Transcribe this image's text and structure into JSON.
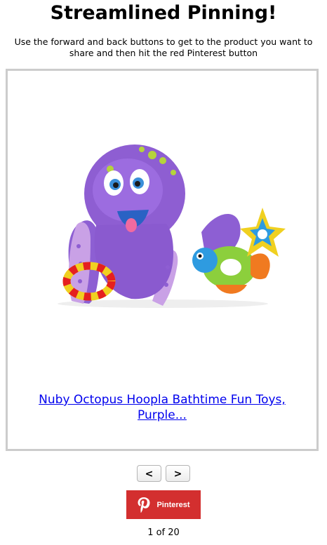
{
  "header": {
    "title": "Streamlined Pinning!",
    "instructions": "Use the forward and back buttons to get to the product you want to share and then hit the red Pinterest button"
  },
  "product": {
    "name": "Nuby Octopus Hoopla Bathtime Fun Toys, Purple...",
    "image_icon": "octopus-toy-image"
  },
  "navigation": {
    "back_label": "<",
    "forward_label": ">"
  },
  "pinterest": {
    "label": "Pinterest",
    "icon": "pinterest-logo-icon",
    "color": "#d32f2f"
  },
  "pagination": {
    "text": "1 of 20",
    "current": 1,
    "total": 20
  }
}
